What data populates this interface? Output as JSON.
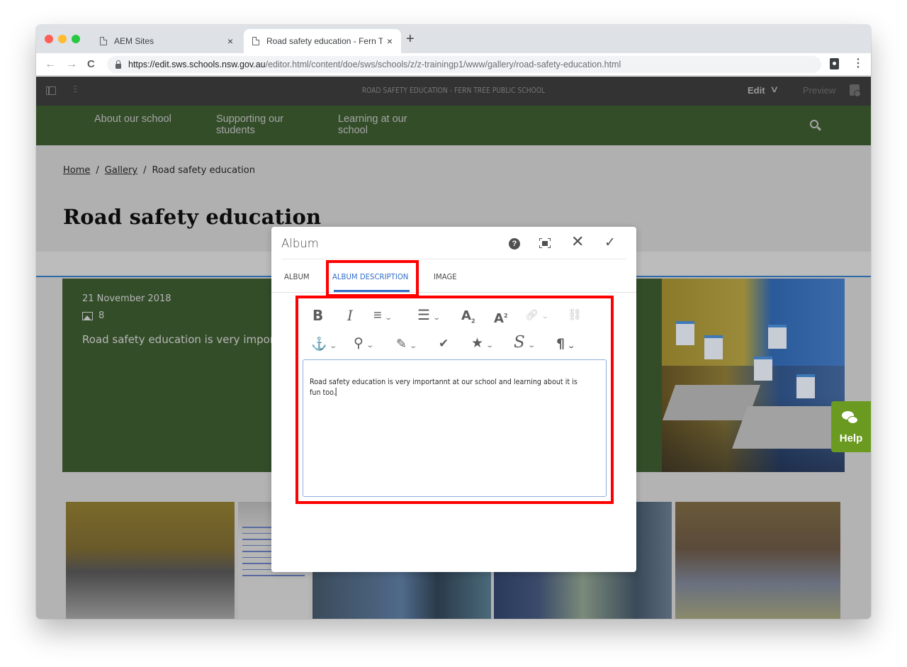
{
  "browser": {
    "tabs": [
      {
        "title": "AEM Sites",
        "active": false
      },
      {
        "title": "Road safety education - Fern T",
        "active": true
      }
    ],
    "new_tab_label": "+",
    "close_glyph": "×",
    "url": {
      "host": "https://edit.sws.schools.nsw.gov.au",
      "path": "/editor.html/content/doe/sws/schools/z/z-trainingp1/www/gallery/road-safety-education.html"
    },
    "icons": {
      "back": "←",
      "forward": "→",
      "reload": "C",
      "menu": "⋮"
    }
  },
  "aem_toolbar": {
    "page_title": "ROAD SAFETY EDUCATION - FERN TREE PUBLIC SCHOOL",
    "mode_label": "Edit",
    "mode_chevron": "∨",
    "preview_label": "Preview",
    "properties_glyph": "⫶⫶"
  },
  "site_nav": {
    "items": [
      {
        "label": "About our school"
      },
      {
        "label": "Supporting our students"
      },
      {
        "label": "Learning at our school"
      }
    ]
  },
  "page": {
    "breadcrumb": [
      {
        "label": "Home",
        "link": true
      },
      {
        "label": "Gallery",
        "link": true
      },
      {
        "label": "Road safety education",
        "link": false
      }
    ],
    "breadcrumb_separator": "/",
    "heading": "Road safety education",
    "album": {
      "date": "21 November 2018",
      "image_count": "8",
      "description": "Road safety education is very importannt at our school and learning about it is fun too."
    },
    "thumbnail_count": 5
  },
  "help_tab": {
    "label": "Help"
  },
  "dialog": {
    "title": "Album",
    "actions": {
      "help": "?",
      "close": "✕",
      "done": "✓"
    },
    "tabs": [
      {
        "label": "ALBUM",
        "active": false
      },
      {
        "label": "ALBUM DESCRIPTION",
        "active": true
      },
      {
        "label": "IMAGE",
        "active": false
      }
    ],
    "rte_toolbar": {
      "row1": [
        {
          "name": "bold",
          "glyph": "B",
          "dropdown": false
        },
        {
          "name": "italic",
          "glyph": "I",
          "dropdown": false
        },
        {
          "name": "align",
          "glyph": "≡",
          "dropdown": true
        },
        {
          "name": "list",
          "glyph": "☰",
          "dropdown": true
        },
        {
          "name": "subscript",
          "glyph": "A",
          "dropdown": false
        },
        {
          "name": "superscript",
          "glyph": "A",
          "dropdown": false
        },
        {
          "name": "link",
          "glyph": "🔗",
          "dropdown": true,
          "disabled": true
        },
        {
          "name": "unlink",
          "glyph": "⛓",
          "dropdown": false,
          "disabled": true
        }
      ],
      "row2": [
        {
          "name": "anchor",
          "glyph": "⚓",
          "dropdown": true
        },
        {
          "name": "find-replace",
          "glyph": "⚲",
          "dropdown": true
        },
        {
          "name": "paste",
          "glyph": "✎",
          "dropdown": true
        },
        {
          "name": "spellcheck",
          "glyph": "✔",
          "dropdown": false
        },
        {
          "name": "special-chars",
          "glyph": "★",
          "dropdown": true
        },
        {
          "name": "styles",
          "glyph": "S",
          "dropdown": true
        },
        {
          "name": "paragraph-format",
          "glyph": "¶",
          "dropdown": true
        }
      ],
      "chevron": "⌄",
      "script_sub": "2",
      "script_sup": "2"
    },
    "editor_text": "Road safety education is very importannt at our school and learning about it is fun too."
  },
  "annotation_color": "#ff0000",
  "accent_colors": {
    "site_green": "#334d29",
    "dialog_blue": "#326ec8",
    "help_green": "#6a9a1f"
  }
}
